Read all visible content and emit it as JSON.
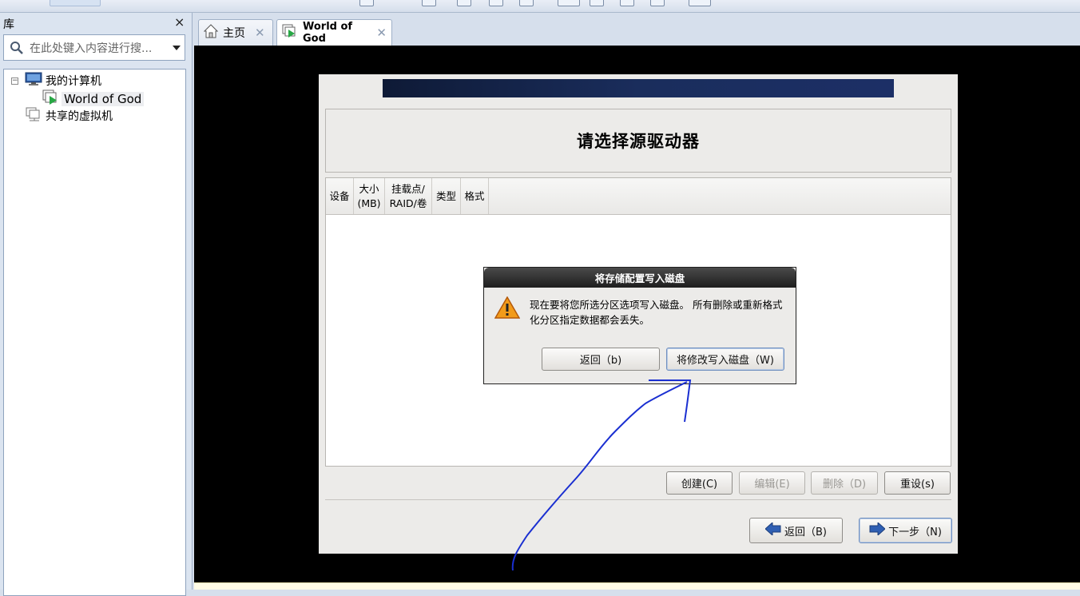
{
  "library": {
    "title": "库",
    "close_icon": "×",
    "search_placeholder": "在此处键入内容进行搜...",
    "tree": {
      "root": "我的计算机",
      "vm": "World of God",
      "shared": "共享的虚拟机"
    }
  },
  "tabs": [
    {
      "label": "主页",
      "icon": "home-icon"
    },
    {
      "label": "World of God",
      "icon": "vm-icon"
    }
  ],
  "installer": {
    "heading": "请选择源驱动器",
    "columns": [
      "设备",
      "大小\n(MB)",
      "挂载点/\nRAID/卷",
      "类型",
      "格式"
    ],
    "buttons": {
      "create": "创建(C)",
      "edit": "编辑(E)",
      "delete": "删除（D)",
      "reset": "重设(s)",
      "back": "返回（B)",
      "next": "下一步（N)"
    }
  },
  "dialog": {
    "title": "将存储配置写入磁盘",
    "message": "现在要将您所选分区选项写入磁盘。 所有删除或重新格式化分区指定数据都会丢失。",
    "back_button": "返回（b)",
    "write_button": "将修改写入磁盘（W)"
  },
  "colors": {
    "accent": "#1a2d5c",
    "annotation": "#1a2fd1",
    "console_bg": "#000000"
  }
}
